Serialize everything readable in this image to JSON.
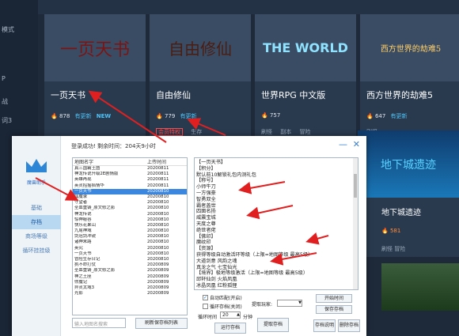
{
  "leftnav": [
    "模式",
    "P",
    "战",
    "词3"
  ],
  "cards": [
    {
      "title": "一页天书",
      "hot": "878",
      "upd": "有更新",
      "extra": "NEW",
      "tags": []
    },
    {
      "title": "自由修仙",
      "hot": "779",
      "upd": "有更新",
      "extra": "",
      "tags": [
        "会员特权",
        "生存"
      ]
    },
    {
      "title": "世界RPG 中文版",
      "hot": "757",
      "upd": "",
      "extra": "",
      "tags": [
        "刷怪",
        "副本",
        "冒险"
      ]
    },
    {
      "title": "西方世界的劫难5",
      "hot": "647",
      "upd": "有更新",
      "extra": "",
      "tags": [
        "刷怪"
      ]
    }
  ],
  "card_images": [
    "一页天书",
    "自由修仙",
    "THE WORLD",
    "西方世界的劫难5"
  ],
  "right_card": {
    "image_text": "地下城遗迹",
    "title": "地下城遗迹",
    "hot": "581",
    "tags": "刷怪  冒险"
  },
  "dialog": {
    "header": "登录成功! 剩余时间：204天9小时",
    "brand": "魔兽助手",
    "nav": [
      "基础",
      "存档",
      "商场等级",
      "循环挂挂级"
    ],
    "list_headers": [
      "地图名字",
      "上传时间"
    ],
    "list_rows": [
      [
        "真三国霸王图",
        "20200811"
      ],
      [
        "神龙传说升级2E剧情版",
        "20200811"
      ],
      [
        "英雄再现",
        "20200811"
      ],
      [
        "英灵招摇掐情华",
        "20200811"
      ],
      [
        "一页天书",
        "20200810"
      ],
      [
        "仙魔录",
        "20200810"
      ],
      [
        "守望者",
        "20200810"
      ],
      [
        "圣血重铸_原文修之影",
        "20200810"
      ],
      [
        "神龙传说",
        "20200810"
      ],
      [
        "惊神秘谷",
        "20200810"
      ],
      [
        "快乐花果山",
        "20200810"
      ],
      [
        "九尾神域",
        "20200810"
      ],
      [
        "剑冠剑冲锐",
        "20200810"
      ],
      [
        "诸神末路",
        "20200810"
      ],
      [
        "英究",
        "20200810"
      ],
      [
        "一页天书",
        "20200810"
      ],
      [
        "冒险生存日记",
        "20200810"
      ],
      [
        "执不命打仗",
        "20200809"
      ],
      [
        "圣血重铸_原文修之影",
        "20200809"
      ],
      [
        "神之王座",
        "20200809"
      ],
      [
        "你魔记",
        "20200809"
      ],
      [
        "异灵太域3",
        "20200809"
      ],
      [
        "光影",
        "20200809"
      ]
    ],
    "selected_index": 4,
    "text_lines": [
      "【一页天书】",
      "【积分】",
      "默认前10解锁礼包内测礼包",
      "【称号】",
      "小师牛刀",
      "一方强豪",
      "智勇双全",
      "霸者盖世",
      "四面名扬",
      "威震宝城",
      "天度之尊",
      "绝世者佬",
      "【佛印】",
      "魔纹印",
      "【资源】",
      "获得等级自动激活环等级（上限=地图等级  最高5级）",
      "大道剑意   风韵之魂",
      "真龙之气   七宝仙光",
      "【境界】极地等级激活（上限=地图等级  最高5级）",
      "邱轩仙剑   火焰凤凰",
      "冰晶凤凰   红粉孤狸",
      "闪光仙雪",
      "【宠物】碧蟒女皇"
    ],
    "search_placeholder": "输入地图名搜索",
    "refresh_label": "刷新保存档列表",
    "auto_label": "自动匹配(开启)",
    "loop_label": "循环存档(关闭)",
    "extract_label": "提取玩家:",
    "loop_time_label": "循环时间",
    "loop_time_value": "20",
    "minute_label": "分钟",
    "run_label": "运行存档",
    "extract_save_label": "提取存档",
    "start_time_label": "开始时间",
    "save_archive_label": "保存存档",
    "save_desc_label": "存档说明",
    "delete_label": "删除存档"
  }
}
